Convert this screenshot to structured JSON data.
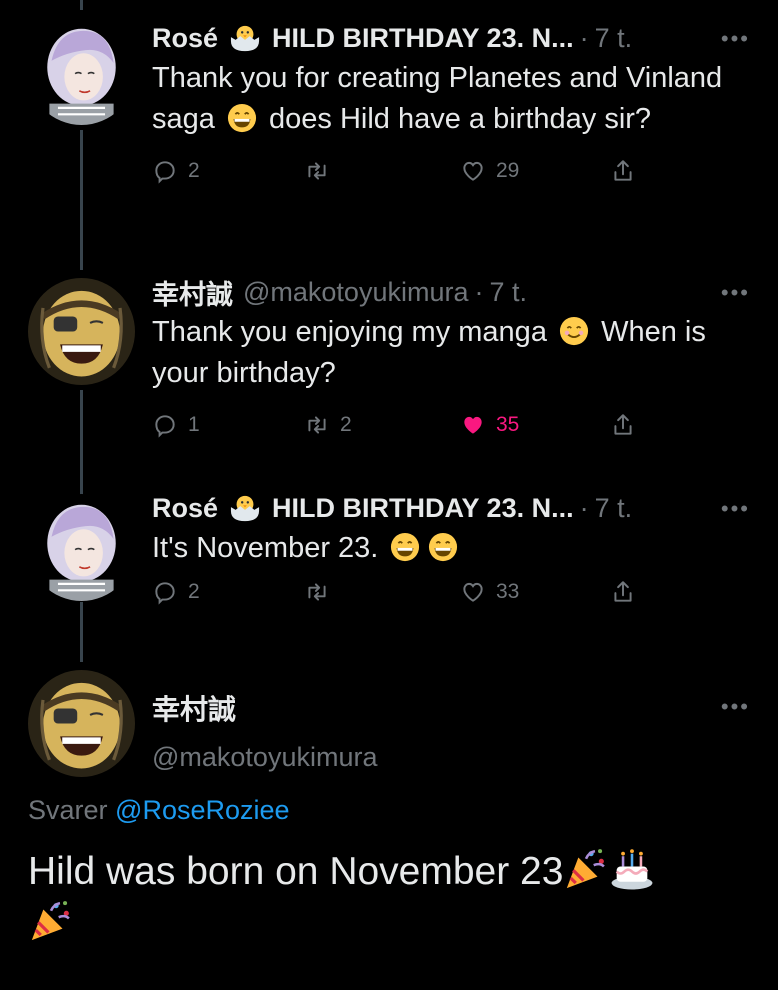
{
  "tweets": [
    {
      "name": "Rosé",
      "label": "HILD BIRTHDAY 23. N...",
      "time": "7 t.",
      "text_a": "Thank you for creating Planetes and Vinland saga",
      "text_b": "does Hild have a birthday sir?",
      "replies": "2",
      "retweets": "",
      "likes": "29"
    },
    {
      "name": "幸村誠",
      "handle": "@makotoyukimura",
      "time": "7 t.",
      "text_a": "Thank you enjoying my manga",
      "text_b": "When is your birthday?",
      "replies": "1",
      "retweets": "2",
      "likes": "35"
    },
    {
      "name": "Rosé",
      "label": "HILD BIRTHDAY 23. N...",
      "time": "7 t.",
      "text_a": "It's November 23.",
      "replies": "2",
      "retweets": "",
      "likes": "33"
    }
  ],
  "final": {
    "name": "幸村誠",
    "handle": "@makotoyukimura",
    "replying_prefix": "Svarer",
    "replying_to": "@RoseRoziee",
    "text": "Hild was born on November 23"
  },
  "icons": [
    "more-icon",
    "reply-icon",
    "retweet-icon",
    "like-icon",
    "share-icon",
    "hatching-chick-emoji",
    "grin-emoji",
    "smile-emoji",
    "party-popper-emoji",
    "cake-emoji"
  ],
  "colors": {
    "background": "#000000",
    "text": "#e7e9ea",
    "muted": "#71767b",
    "link": "#1d9bf0",
    "like": "#f91880",
    "thread": "#38444d"
  }
}
